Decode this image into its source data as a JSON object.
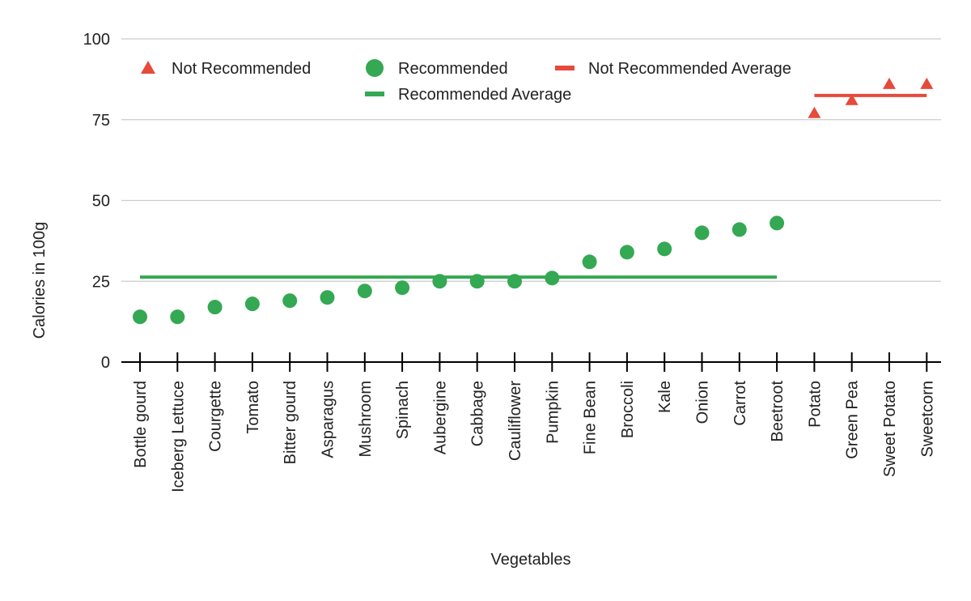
{
  "chart_data": {
    "type": "scatter",
    "title": "",
    "xlabel": "Vegetables",
    "ylabel": "Calories in 100g",
    "ylim": [
      0,
      100
    ],
    "yticks": [
      0,
      25,
      50,
      75,
      100
    ],
    "grid": true,
    "legend_position": "top",
    "categories": [
      "Bottle gourd",
      "Iceberg Lettuce",
      "Courgette",
      "Tomato",
      "Bitter gourd",
      "Asparagus",
      "Mushroom",
      "Spinach",
      "Aubergine",
      "Cabbage",
      "Cauliflower",
      "Pumpkin",
      "Fine Bean",
      "Broccoli",
      "Kale",
      "Onion",
      "Carrot",
      "Beetroot",
      "Potato",
      "Green Pea",
      "Sweet Potato",
      "Sweetcorn"
    ],
    "series": [
      {
        "name": "Not Recommended",
        "marker": "triangle",
        "color": "#e64a3b",
        "values": [
          null,
          null,
          null,
          null,
          null,
          null,
          null,
          null,
          null,
          null,
          null,
          null,
          null,
          null,
          null,
          null,
          null,
          null,
          77,
          81,
          86,
          86
        ]
      },
      {
        "name": "Recommended",
        "marker": "circle",
        "color": "#34a853",
        "values": [
          14,
          14,
          17,
          18,
          19,
          20,
          22,
          23,
          25,
          25,
          25,
          26,
          31,
          34,
          35,
          40,
          41,
          43,
          null,
          null,
          null,
          null
        ]
      },
      {
        "name": "Not Recommended Average",
        "marker": "line",
        "color": "#e64a3b",
        "value": 82.5,
        "range": [
          "Potato",
          "Sweetcorn"
        ]
      },
      {
        "name": "Recommended Average",
        "marker": "line",
        "color": "#34a853",
        "value": 26.3,
        "range": [
          "Bottle gourd",
          "Beetroot"
        ]
      }
    ]
  }
}
